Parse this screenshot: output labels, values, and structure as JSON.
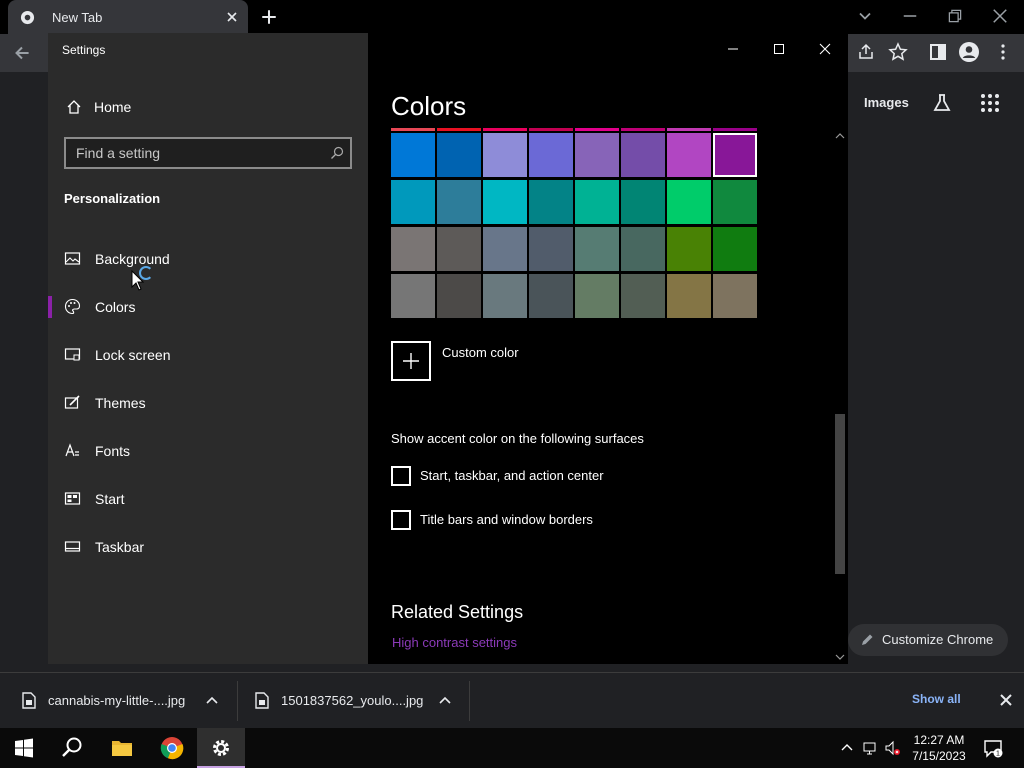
{
  "browser": {
    "tab_title": "New Tab",
    "images_link": "Images",
    "customize_label": "Customize Chrome"
  },
  "settings": {
    "window_title": "Settings",
    "home_label": "Home",
    "search_placeholder": "Find a setting",
    "section_title": "Personalization",
    "nav": [
      {
        "label": "Background",
        "icon": "picture-icon"
      },
      {
        "label": "Colors",
        "icon": "palette-icon",
        "selected": true
      },
      {
        "label": "Lock screen",
        "icon": "lock-screen-icon"
      },
      {
        "label": "Themes",
        "icon": "themes-icon"
      },
      {
        "label": "Fonts",
        "icon": "fonts-icon"
      },
      {
        "label": "Start",
        "icon": "start-icon"
      },
      {
        "label": "Taskbar",
        "icon": "taskbar-icon"
      }
    ],
    "page_heading": "Colors",
    "accent_colors": [
      [
        "#0078d7",
        "#0063b1",
        "#8e8cd8",
        "#6b69d6",
        "#8764b8",
        "#744da9",
        "#b146c2",
        "#881798"
      ],
      [
        "#0099bc",
        "#2d7d9a",
        "#00b7c3",
        "#038387",
        "#00b294",
        "#018574",
        "#00cc6a",
        "#10893e"
      ],
      [
        "#7a7574",
        "#5d5a58",
        "#68768a",
        "#515c6b",
        "#567c73",
        "#486860",
        "#498205",
        "#107c10"
      ],
      [
        "#767676",
        "#4c4a48",
        "#69797e",
        "#4a5459",
        "#647c64",
        "#525e54",
        "#847545",
        "#7e735f"
      ]
    ],
    "selected_color": "#881798",
    "custom_color_label": "Custom color",
    "surfaces_heading": "Show accent color on the following surfaces",
    "checkbox_start": "Start, taskbar, and action center",
    "checkbox_titlebars": "Title bars and window borders",
    "related_heading": "Related Settings",
    "high_contrast_link": "High contrast settings"
  },
  "downloads": {
    "items": [
      {
        "name": "cannabis-my-little-....jpg"
      },
      {
        "name": "1501837562_youlo....jpg"
      }
    ],
    "show_all": "Show all"
  },
  "taskbar": {
    "time": "12:27 AM",
    "date": "7/15/2023",
    "notification_count": "1"
  }
}
